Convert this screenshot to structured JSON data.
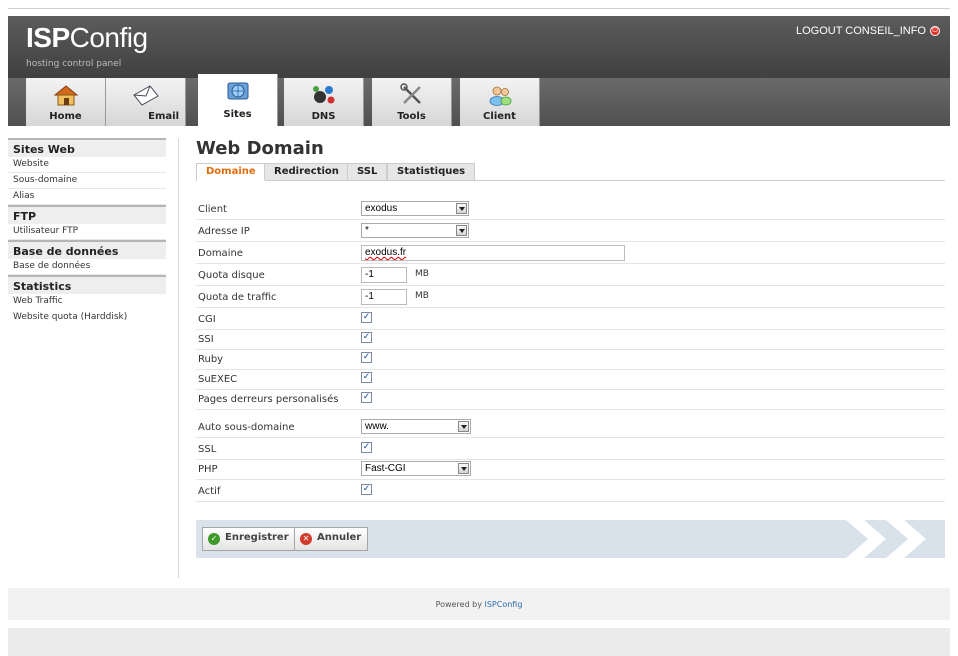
{
  "header": {
    "logo_bold": "ISP",
    "logo_light": "Config",
    "tagline": "hosting control panel",
    "logout_label": "LOGOUT CONSEIL_INFO"
  },
  "main_tabs": [
    {
      "label": "Home",
      "icon": "home-icon"
    },
    {
      "label": "Email",
      "icon": "envelope-icon"
    },
    {
      "label": "Sites",
      "icon": "globe-sites-icon"
    },
    {
      "label": "DNS",
      "icon": "network-icon"
    },
    {
      "label": "Tools",
      "icon": "wrench-tools-icon"
    },
    {
      "label": "Client",
      "icon": "users-icon"
    }
  ],
  "sidebar": {
    "groups": [
      {
        "title": "Sites Web",
        "items": [
          "Website",
          "Sous-domaine",
          "Alias"
        ]
      },
      {
        "title": "FTP",
        "items": [
          "Utilisateur FTP"
        ]
      },
      {
        "title": "Base de données",
        "items": [
          "Base de données"
        ]
      },
      {
        "title": "Statistics",
        "items": [
          "Web Traffic",
          "Website quota (Harddisk)"
        ]
      }
    ]
  },
  "page": {
    "title": "Web Domain",
    "tabs": [
      "Domaine",
      "Redirection",
      "SSL",
      "Statistiques"
    ]
  },
  "form": {
    "client": {
      "label": "Client",
      "value": "exodus"
    },
    "ip": {
      "label": "Adresse IP",
      "value": "*"
    },
    "domain": {
      "label": "Domaine",
      "value": "exodus.fr"
    },
    "quota_disk": {
      "label": "Quota disque",
      "value": "-1",
      "unit": "MB"
    },
    "quota_traffic": {
      "label": "Quota de traffic",
      "value": "-1",
      "unit": "MB"
    },
    "cgi": {
      "label": "CGI",
      "checked": true
    },
    "ssi": {
      "label": "SSI",
      "checked": true
    },
    "ruby": {
      "label": "Ruby",
      "checked": true
    },
    "suexec": {
      "label": "SuEXEC",
      "checked": true
    },
    "error_pages": {
      "label": "Pages derreurs personalisés",
      "checked": true
    },
    "auto_sub": {
      "label": "Auto sous-domaine",
      "value": "www."
    },
    "ssl": {
      "label": "SSL",
      "checked": true
    },
    "php": {
      "label": "PHP",
      "value": "Fast-CGI"
    },
    "active": {
      "label": "Actif",
      "checked": true
    }
  },
  "actions": {
    "save_label": "Enregistrer",
    "cancel_label": "Annuler"
  },
  "footer": {
    "prefix": "Powered by ",
    "link": "ISPConfig"
  },
  "colors": {
    "active_tab_text": "#e36c0a",
    "action_bar": "#d9e1ea",
    "save_icon": "#3e9a2a",
    "cancel_icon": "#d23a2e"
  }
}
